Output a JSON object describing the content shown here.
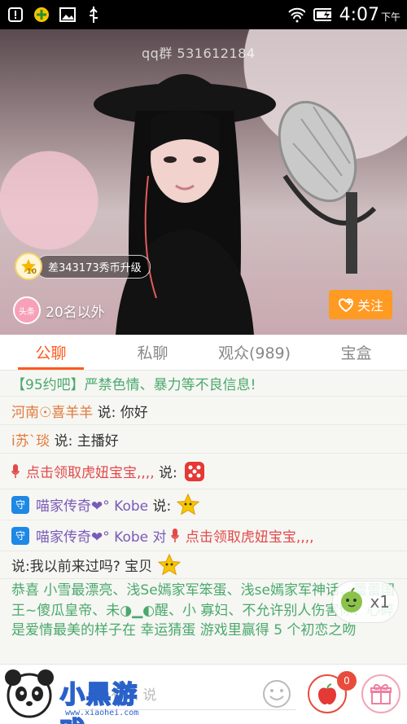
{
  "status_bar": {
    "time": "4:07",
    "ampm": "下午"
  },
  "video": {
    "watermark": "qq群 531612184",
    "level_text": "差343173秀币升级",
    "level_number": "10",
    "rank_badge_text": "头条",
    "rank_text": "20名以外",
    "follow_label": "关注"
  },
  "tabs": [
    {
      "label": "公聊",
      "active": true
    },
    {
      "label": "私聊",
      "active": false
    },
    {
      "label": "观众(989)",
      "active": false
    },
    {
      "label": "宝盒",
      "active": false
    }
  ],
  "chat": {
    "notice": "【95约吧】严禁色情、暴力等不良信息!",
    "msg1": {
      "user": "河南☉喜羊羊",
      "say": "说:",
      "text": "你好"
    },
    "msg2": {
      "user": "i苏`琰",
      "say": "说:",
      "text": "主播好"
    },
    "msg3": {
      "text": "点击领取虎妞宝宝,,,,",
      "say": "说:"
    },
    "msg4": {
      "vip": "守",
      "user": "喵家传奇❤° Kobe",
      "say": "说:"
    },
    "msg5": {
      "vip": "守",
      "user": "喵家传奇❤° Kobe",
      "to": "对",
      "target": "点击领取虎妞宝宝,,,,"
    },
    "msg6": {
      "text": "说:我以前来过吗? 宝贝"
    },
    "msg7": {
      "text": "恭喜 小雪最漂亮、浅Se嫣家军笨蛋、浅se嫣家军神话、蕾蕾国王~傻瓜皇帝、未◑▁◐醒、小 寡妇、不允许别人伤害你、心碎是爱情最美的样子在 幸运猜蛋 游戏里赢得 5 个初恋之吻"
    },
    "gift_count": "x1"
  },
  "bottom": {
    "input_placeholder": "有人 说",
    "apple_count": "0",
    "logo_text": "小黑游戏",
    "logo_url": "www.xiaohei.com"
  }
}
